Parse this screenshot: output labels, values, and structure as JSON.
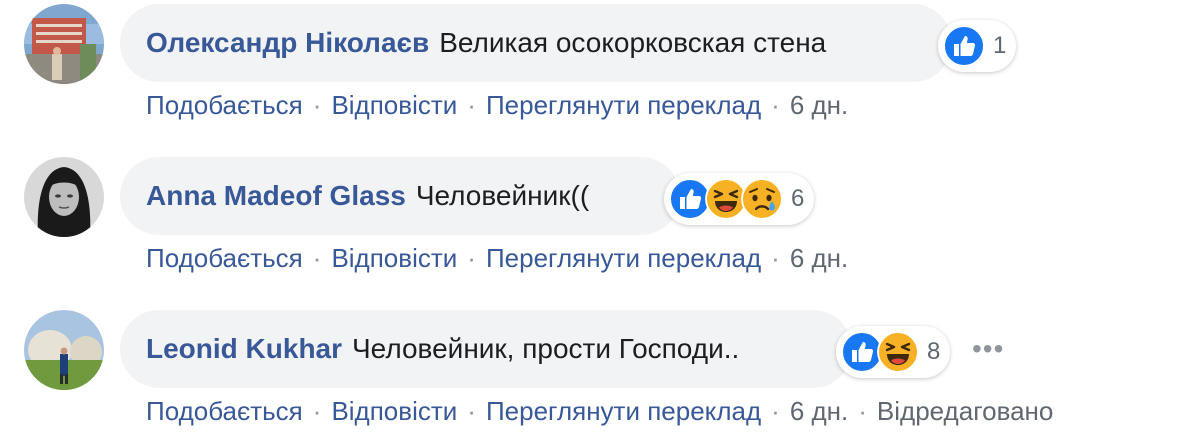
{
  "comments": [
    {
      "author": "Олександр Ніколаєв",
      "text": "Великая осокорковская стена",
      "reaction_count": "1",
      "reactions": [
        "like"
      ],
      "actions": {
        "like": "Подобається",
        "reply": "Відповісти",
        "translate": "Переглянути переклад"
      },
      "time": "6 дн.",
      "edited": ""
    },
    {
      "author": "Anna Madeof Glass",
      "text": "Человейник((",
      "reaction_count": "6",
      "reactions": [
        "like",
        "haha",
        "sad"
      ],
      "actions": {
        "like": "Подобається",
        "reply": "Відповісти",
        "translate": "Переглянути переклад"
      },
      "time": "6 дн.",
      "edited": ""
    },
    {
      "author": "Leonid Kukhar",
      "text": "Человейник, прости Господи..",
      "reaction_count": "8",
      "reactions": [
        "like",
        "haha"
      ],
      "actions": {
        "like": "Подобається",
        "reply": "Відповісти",
        "translate": "Переглянути переклад"
      },
      "time": "6 дн.",
      "edited": "Відредаговано"
    }
  ],
  "separator": "·",
  "colors": {
    "author": "#385898",
    "link": "#385898",
    "bubble": "#f2f3f5",
    "meta": "#606770",
    "like": "#1877f2",
    "emoji": "#f7b125"
  }
}
